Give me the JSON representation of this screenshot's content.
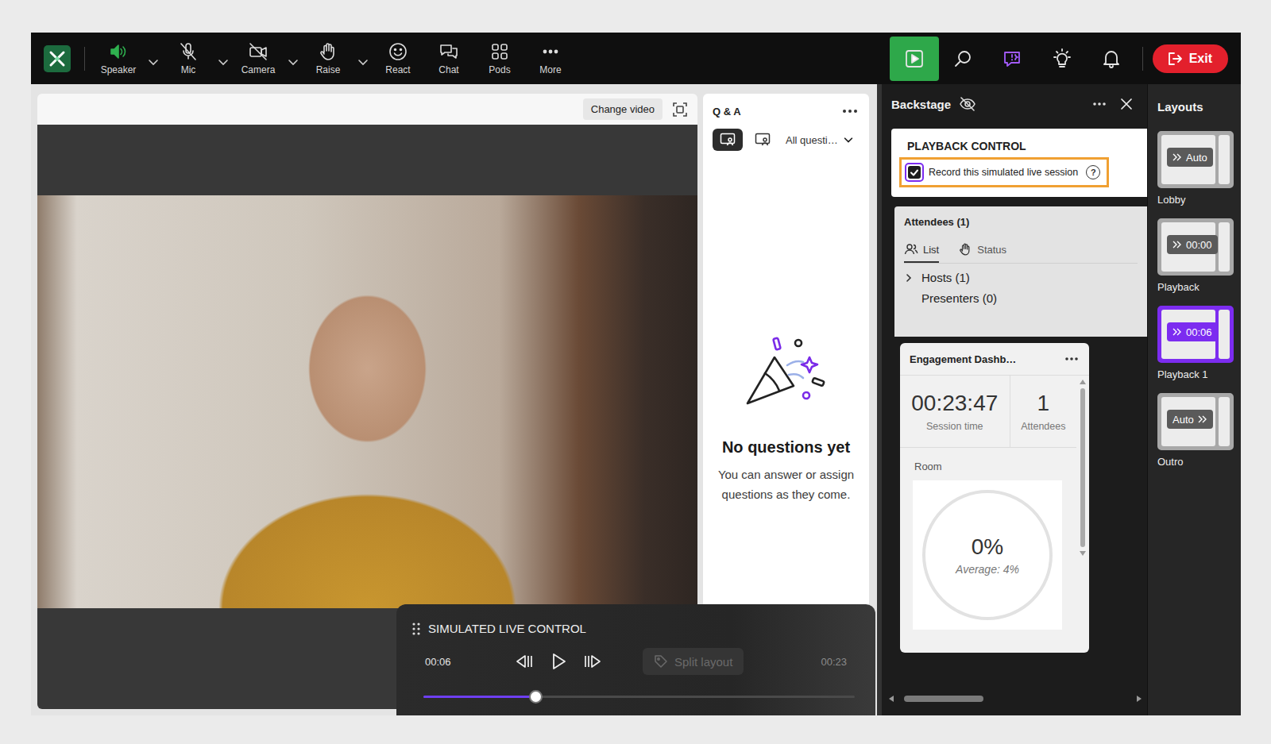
{
  "toolbar": {
    "items": [
      {
        "label": "Speaker",
        "kind": "speaker",
        "on": true,
        "dropdown": true
      },
      {
        "label": "Mic",
        "kind": "mic",
        "on": false,
        "dropdown": true
      },
      {
        "label": "Camera",
        "kind": "camera",
        "on": false,
        "dropdown": true
      },
      {
        "label": "Raise",
        "kind": "raise",
        "on": false,
        "dropdown": true
      },
      {
        "label": "React",
        "kind": "react",
        "on": false,
        "dropdown": false
      },
      {
        "label": "Chat",
        "kind": "chat",
        "on": false,
        "dropdown": false
      },
      {
        "label": "Pods",
        "kind": "pods",
        "on": false,
        "dropdown": false
      },
      {
        "label": "More",
        "kind": "more",
        "on": false,
        "dropdown": false
      }
    ],
    "tools": [
      {
        "kind": "stage",
        "selected": true,
        "highlighted": false
      },
      {
        "kind": "search",
        "selected": false,
        "highlighted": false
      },
      {
        "kind": "qa",
        "selected": false,
        "highlighted": true
      },
      {
        "kind": "bulb",
        "selected": false,
        "highlighted": false
      },
      {
        "kind": "bell",
        "selected": false,
        "highlighted": false
      }
    ],
    "exit": "Exit"
  },
  "stage": {
    "change_video": "Change video"
  },
  "qa": {
    "title": "Q & A",
    "views": [
      {
        "kind": "presenter",
        "selected": true
      },
      {
        "kind": "attendee",
        "selected": false
      }
    ],
    "filter": "All questi…",
    "empty_title": "No questions yet",
    "empty_text": "You can answer or assign questions as they come."
  },
  "control": {
    "title": "SIMULATED LIVE CONTROL",
    "elapsed": "00:06",
    "total": "00:23",
    "level": 0.26,
    "playing": false,
    "split": {
      "label": "Split layout",
      "disabled": true
    }
  },
  "backstage": {
    "title": "Backstage",
    "playback": {
      "heading": "PLAYBACK CONTROL",
      "record_label": "Record this simulated live session",
      "record_checked": true,
      "help": "?"
    },
    "attendees": {
      "title": "Attendees (1)",
      "tabs": [
        {
          "label": "List",
          "selected": true
        },
        {
          "label": "Status",
          "selected": false
        }
      ],
      "groups": [
        {
          "label": "Hosts (1)",
          "has_members": true
        },
        {
          "label": "Presenters (0)",
          "has_members": false
        }
      ]
    },
    "dashboard": {
      "title": "Engagement Dashb…",
      "session_time": "00:23:47",
      "session_label": "Session time",
      "attendees": "1",
      "attendees_label": "Attendees",
      "room_label": "Room",
      "room_value": "0%",
      "room_level": 0,
      "average": "Average: 4%"
    }
  },
  "layouts": {
    "title": "Layouts",
    "items": [
      {
        "label": "Lobby",
        "badge": "Auto",
        "kind": "lead",
        "selected": false
      },
      {
        "label": "Playback",
        "badge": "00:00",
        "kind": "lead",
        "selected": false
      },
      {
        "label": "Playback 1",
        "badge": "00:06",
        "kind": "lead",
        "selected": true
      },
      {
        "label": "Outro",
        "badge": "Auto",
        "kind": "trail",
        "selected": false
      }
    ]
  }
}
